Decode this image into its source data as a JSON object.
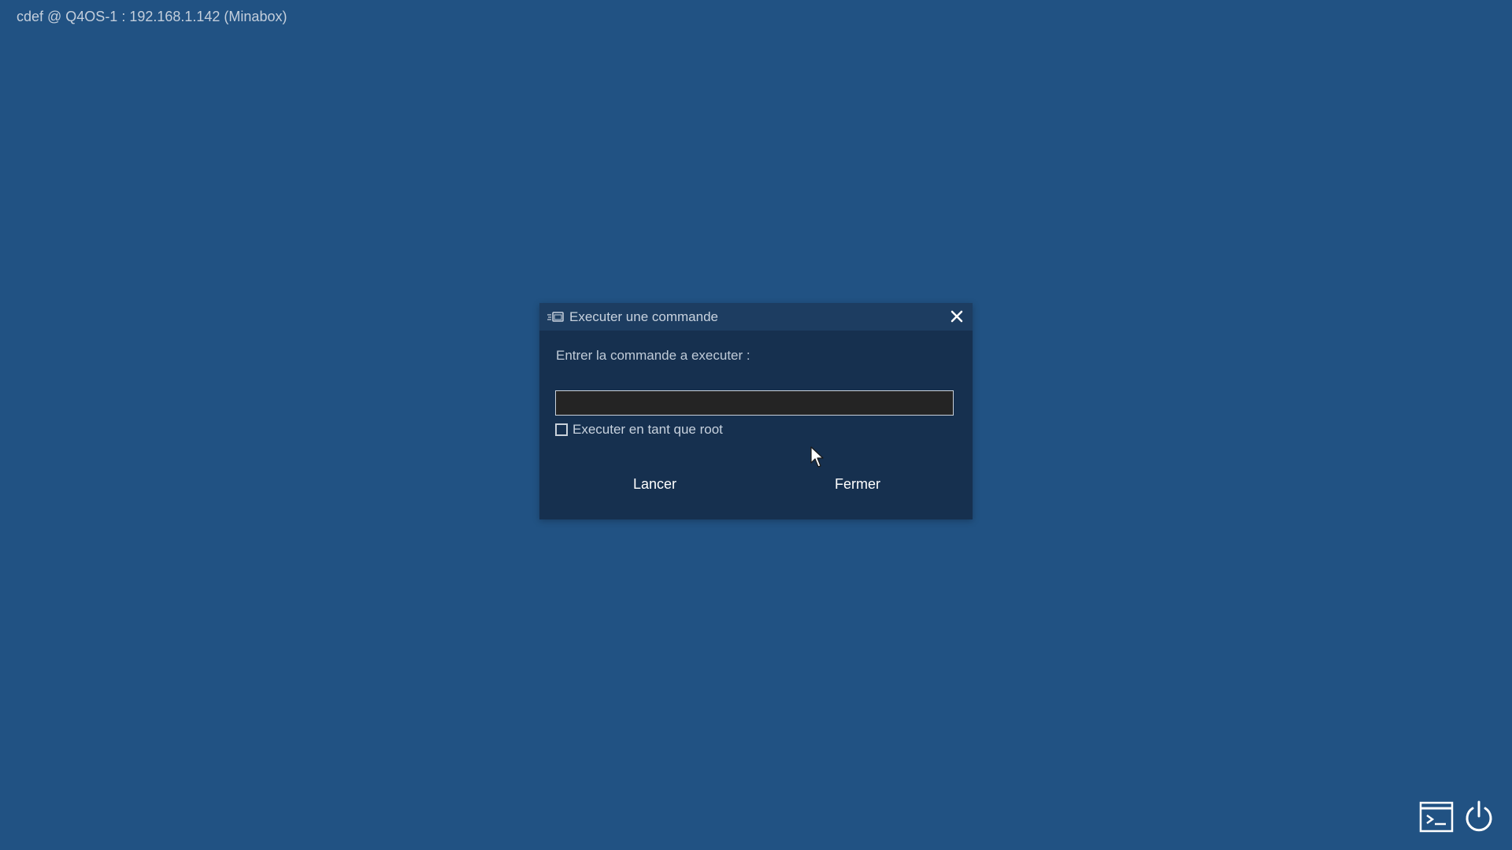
{
  "desktop": {
    "host_label": "cdef @ Q4OS-1 : 192.168.1.142 (Minabox)"
  },
  "dialog": {
    "title": "Executer une commande",
    "title_icon": "run-command-icon",
    "close_icon": "close-icon",
    "prompt": "Entrer la commande a executer :",
    "command_value": "",
    "run_as_root_label": "Executer en tant que root",
    "run_as_root_checked": false,
    "launch_label": "Lancer",
    "close_label": "Fermer"
  },
  "tray": {
    "terminal_icon": "terminal-icon",
    "power_icon": "power-icon"
  },
  "colors": {
    "desktop_bg": "#215283",
    "dialog_bg": "#16304f",
    "titlebar_bg": "#1d3d61",
    "input_bg": "#242424"
  }
}
